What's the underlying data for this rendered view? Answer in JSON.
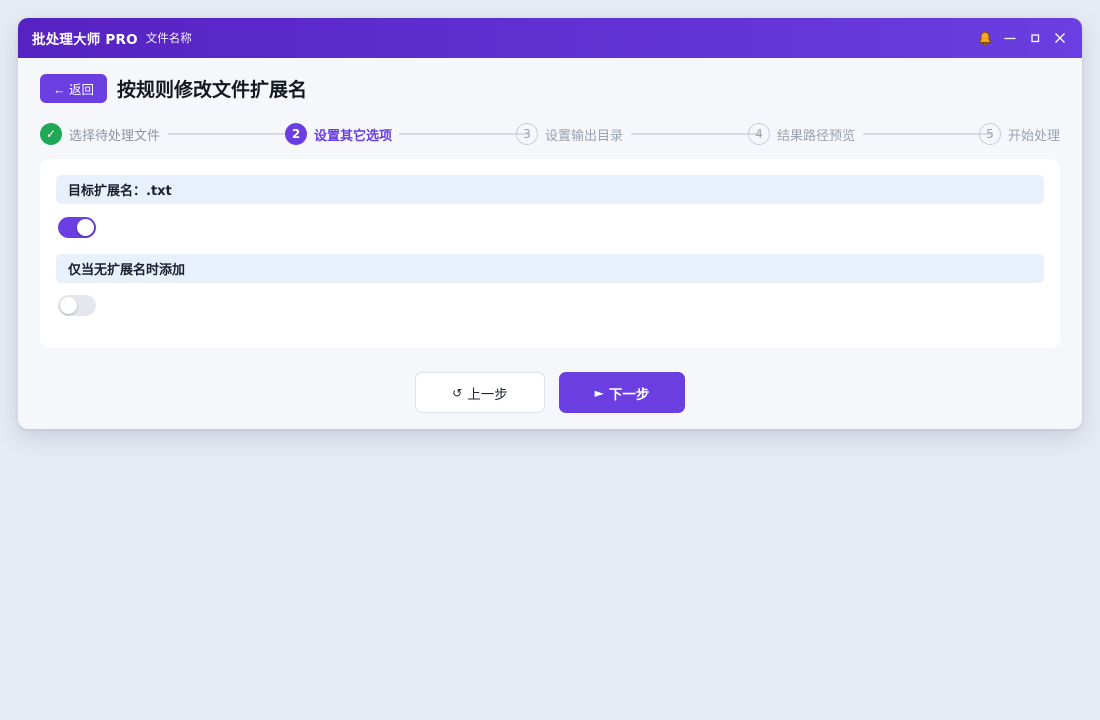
{
  "titlebar": {
    "app_title": "批处理大师 PRO",
    "file_name": "文件名称",
    "icons": [
      "bell-icon",
      "minimize-icon",
      "maximize-icon",
      "close-icon"
    ],
    "gradient": [
      "#5622c2",
      "#6a3ee0"
    ]
  },
  "header": {
    "back_label": "← 返回",
    "page_title": "按规则修改文件扩展名"
  },
  "stepper": {
    "steps": [
      {
        "number": "✓",
        "label": "选择待处理文件",
        "state": "done"
      },
      {
        "number": "2",
        "label": "设置其它选项",
        "state": "active"
      },
      {
        "number": "3",
        "label": "设置输出目录",
        "state": "todo"
      },
      {
        "number": "4",
        "label": "结果路径预览",
        "state": "todo"
      },
      {
        "number": "5",
        "label": "开始处理",
        "state": "todo"
      }
    ]
  },
  "options": {
    "target_ext_label": "目标扩展名：.txt",
    "target_ext_toggle": true,
    "only_add_label": "仅当无扩展名时添加",
    "only_add_toggle": false
  },
  "footer": {
    "prev_icon": "↺",
    "prev_label": "上一步",
    "next_icon": "►",
    "next_label": "下一步"
  },
  "colors": {
    "accent": "#6a3ee0",
    "done": "#1fa855",
    "bell": "#f5a524"
  }
}
